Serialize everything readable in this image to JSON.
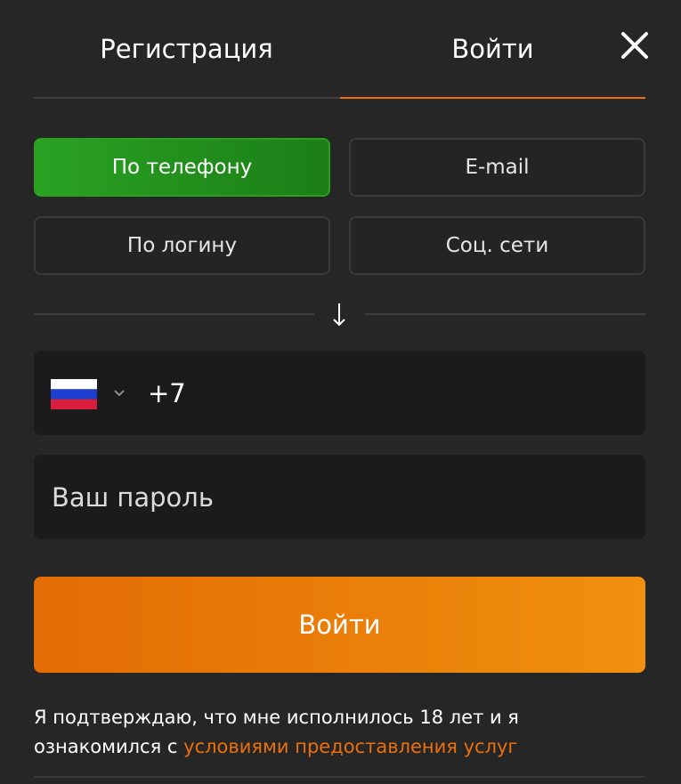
{
  "tabs": {
    "register_label": "Регистрация",
    "login_label": "Войти",
    "active": "login"
  },
  "close_icon": "close-icon",
  "methods": {
    "phone_label": "По телефону",
    "email_label": "E-mail",
    "login_label": "По логину",
    "social_label": "Соц. сети",
    "active": "phone"
  },
  "divider_icon": "arrow-down-icon",
  "phone": {
    "country_flag": "russia-flag-icon",
    "prefix_value": "+7"
  },
  "password": {
    "placeholder": "Ваш пароль"
  },
  "submit_label": "Войти",
  "consent": {
    "text": "Я подтверждаю, что мне исполнилось 18 лет и я ознакомился с ",
    "link_text": "условиями предоставления услуг"
  },
  "colors": {
    "background": "#262626",
    "accent": "#e9700c",
    "active_method": "#23931d",
    "field_bg": "#1b1b1b"
  }
}
